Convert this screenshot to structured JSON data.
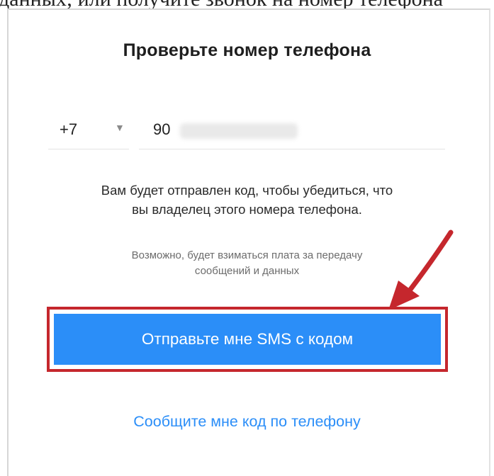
{
  "top_text": "данных; или получите звонок на номер телефона",
  "dialog": {
    "title": "Проверьте номер телефона",
    "country_code": "+7",
    "phone_value": "90",
    "info_line1": "Вам будет отправлен код, чтобы убедиться, что",
    "info_line2": "вы владелец этого номера телефона.",
    "fee_line1": "Возможно, будет взиматься плата за передачу",
    "fee_line2": "сообщений и данных",
    "send_sms_label": "Отправьте мне SMS с кодом",
    "call_label": "Сообщите мне код по телефону"
  },
  "icons": {
    "country_dropdown": "chevron-down-icon",
    "annotation_arrow": "red-arrow-icon"
  },
  "colors": {
    "primary": "#2b8ef8",
    "highlight_border": "#c5272d",
    "annotation_arrow": "#c5272d"
  }
}
